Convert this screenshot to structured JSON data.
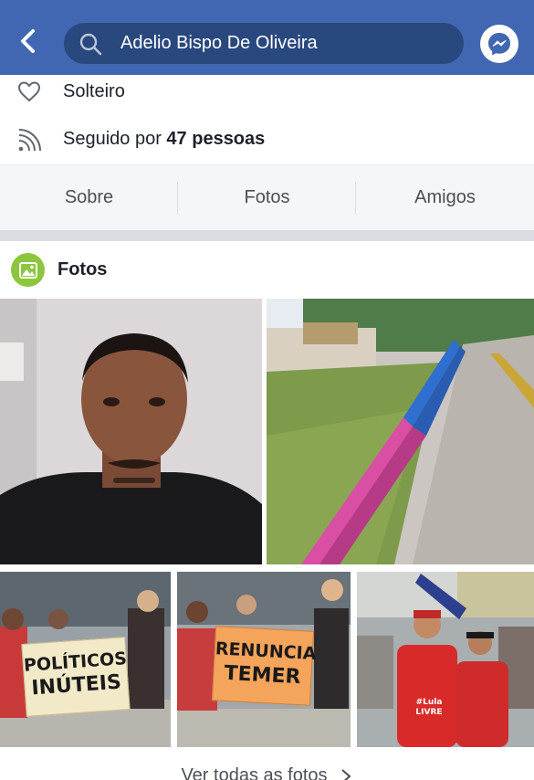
{
  "header": {
    "search_value": "Adelio Bispo De Oliveira",
    "colors": {
      "bar": "#4267b2",
      "search_bg": "#29487d"
    }
  },
  "about": {
    "relationship": "Solteiro",
    "followed_prefix": "Seguido por ",
    "followed_count": "47 pessoas"
  },
  "tabs": [
    "Sobre",
    "Fotos",
    "Amigos"
  ],
  "photos": {
    "title": "Fotos",
    "sign_1_line1": "POLÍTICOS",
    "sign_1_line2": "INÚTEIS",
    "sign_2_line1": "RENUNCIA",
    "sign_2_line2": "TEMER",
    "shirt_text_1": "#Lula",
    "shirt_text_2": "LIVRE",
    "see_all": "Ver todas as fotos"
  }
}
